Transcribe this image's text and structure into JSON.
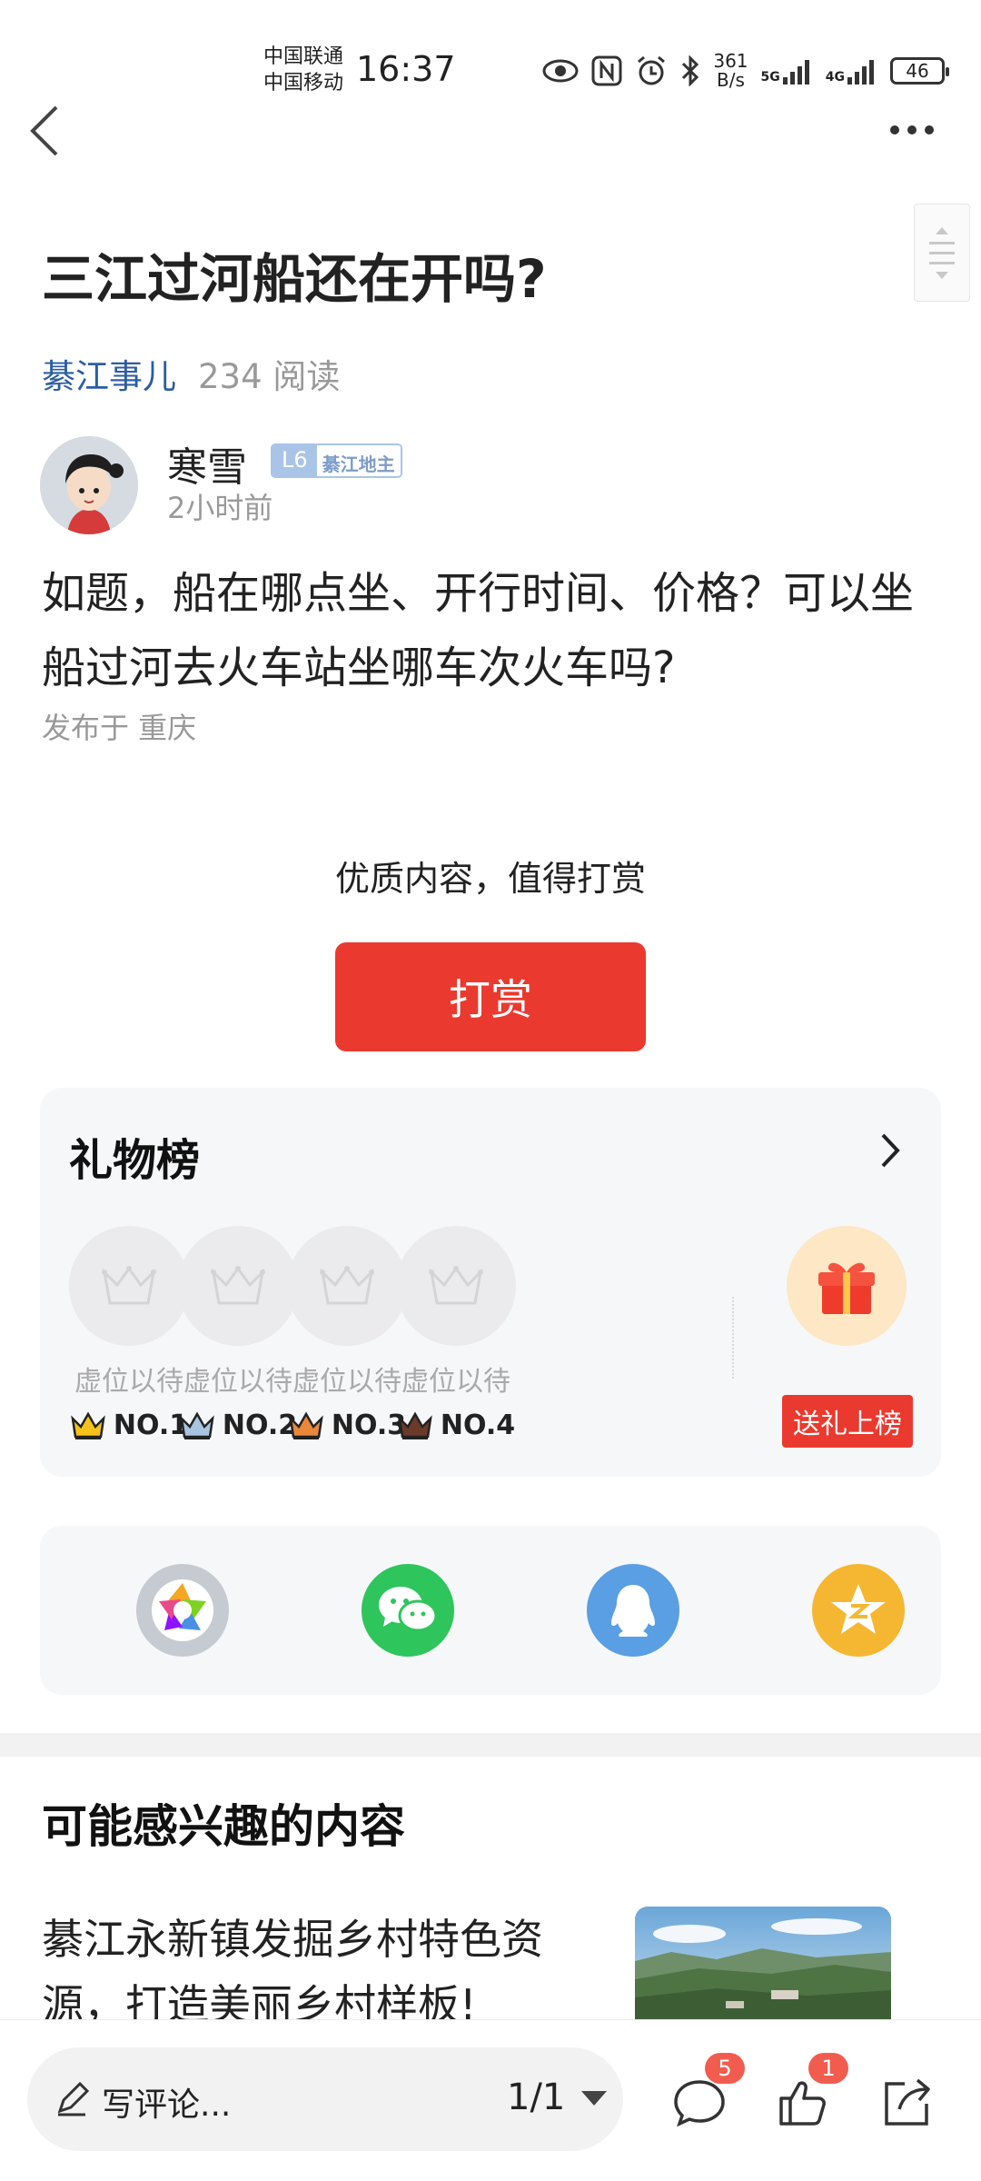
{
  "status_bar": {
    "carrier1": "中国联通",
    "carrier2": "中国移动",
    "time": "16:37",
    "speed_value": "361",
    "speed_unit": "B/s",
    "net1": "5G",
    "net2": "4G",
    "battery": "46"
  },
  "article": {
    "title": "三江过河船还在开吗?",
    "circle": "綦江事儿",
    "reads": "234 阅读",
    "author": {
      "name": "寒雪",
      "level": "L6",
      "level_tag": "綦江地主",
      "time": "2小时前"
    },
    "body": "如题，船在哪点坐、开行时间、价格？可以坐船过河去火车站坐哪车次火车吗?",
    "location": "发布于 重庆"
  },
  "reward": {
    "prompt": "优质内容，值得打赏",
    "button": "打赏"
  },
  "gift_board": {
    "title": "礼物榜",
    "slots": [
      {
        "label": "虚位以待",
        "rank": "NO.1",
        "color": "#f5c21b"
      },
      {
        "label": "虚位以待",
        "rank": "NO.2",
        "color": "#a9c4e0"
      },
      {
        "label": "虚位以待",
        "rank": "NO.3",
        "color": "#e9873a"
      },
      {
        "label": "虚位以待",
        "rank": "NO.4",
        "color": "#6b3a2a"
      }
    ],
    "send_gift_button": "送礼上榜"
  },
  "share": {
    "icons": [
      "moments-icon",
      "wechat-icon",
      "qq-icon",
      "qzone-icon"
    ]
  },
  "recommend": {
    "title": "可能感兴趣的内容",
    "items": [
      {
        "text": "綦江永新镇发掘乡村特色资源，打造美丽乡村样板!"
      }
    ]
  },
  "bottom_bar": {
    "comment_placeholder": "写评论...",
    "page": "1/1",
    "comment_count": "5",
    "like_count": "1"
  },
  "colors": {
    "accent_red": "#ea3a2f",
    "link_blue": "#2b5da1"
  }
}
